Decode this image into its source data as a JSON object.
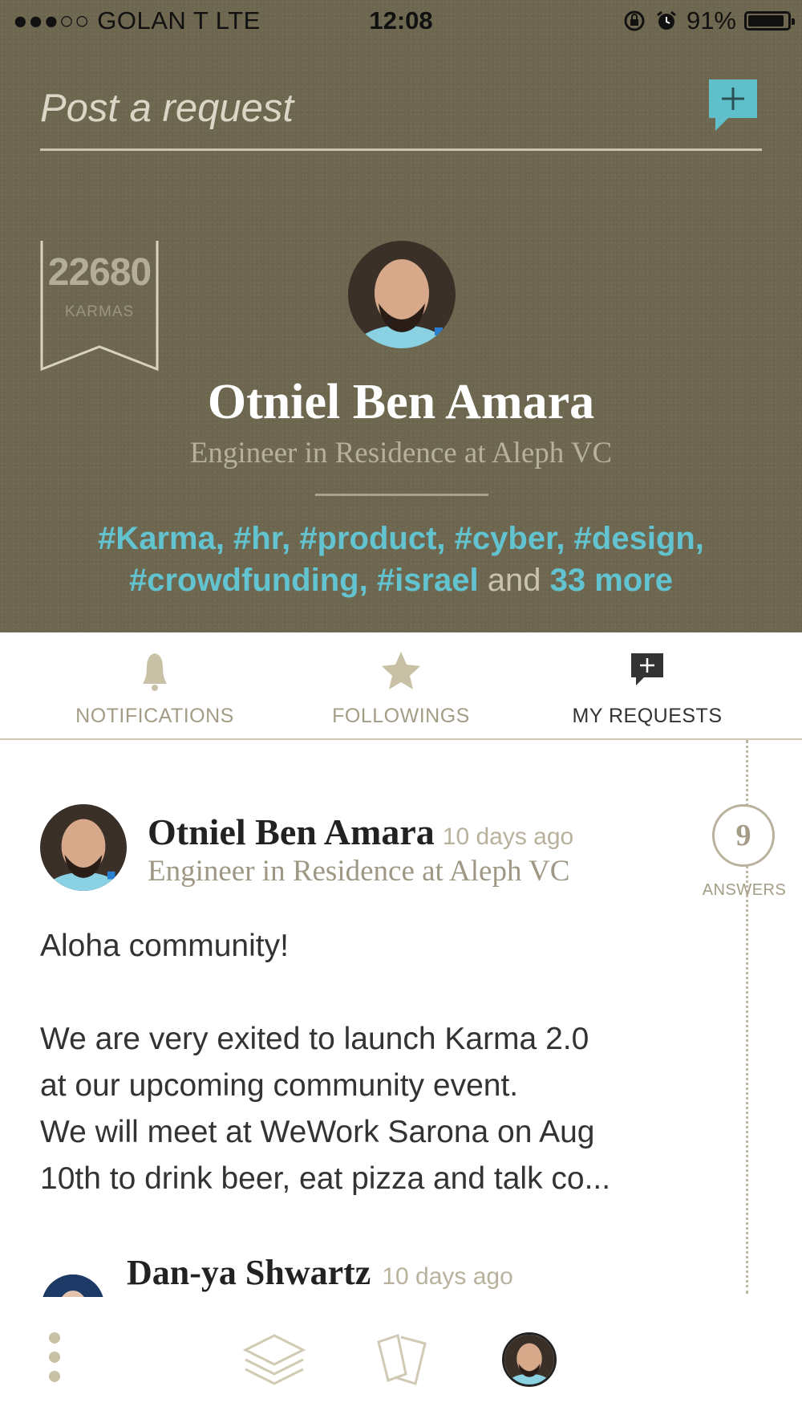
{
  "status_bar": {
    "carrier": "●●●○○ GOLAN T   LTE",
    "time": "12:08",
    "battery": "91%",
    "battery_level": 0.91
  },
  "post": {
    "placeholder": "Post a request",
    "button_icon": "chat-plus-icon"
  },
  "profile": {
    "karma_count": "22680",
    "karma_label": "KARMAS",
    "name": "Otniel Ben Amara",
    "title": "Engineer in Residence at Aleph VC",
    "tags_line1": "#Karma, #hr, #product, #cyber, #design,",
    "tags_line2": "#crowdfunding, #israel",
    "tags_and": "and",
    "tags_more": "33 more"
  },
  "tabs": [
    {
      "label": "NOTIFICATIONS",
      "icon": "bell-icon",
      "active": false
    },
    {
      "label": "FOLLOWINGS",
      "icon": "star-icon",
      "active": false
    },
    {
      "label": "MY REQUESTS",
      "icon": "chat-plus-icon",
      "active": true
    }
  ],
  "request": {
    "author": "Otniel Ben Amara",
    "time": "10 days ago",
    "author_title": "Engineer in Residence at Aleph VC",
    "answers_count": "9",
    "answers_label": "ANSWERS",
    "body_line1": "Aloha community!",
    "body_line2": "We are very exited to launch Karma 2.0",
    "body_line3": "at our upcoming community event.",
    "body_line4": "We will meet at WeWork Sarona on Aug",
    "body_line5": "10th to drink beer, eat pizza and talk co..."
  },
  "reply": {
    "author": "Dan-ya Shwartz",
    "time": "10 days ago"
  },
  "bottom_nav": [
    {
      "icon": "more-vertical-icon"
    },
    {
      "icon": "layers-icon"
    },
    {
      "icon": "cards-icon"
    },
    {
      "icon": "profile-avatar-icon"
    }
  ],
  "colors": {
    "hero_bg": "#6e6750",
    "accent": "#5fc0cc",
    "muted": "#a39c86"
  }
}
